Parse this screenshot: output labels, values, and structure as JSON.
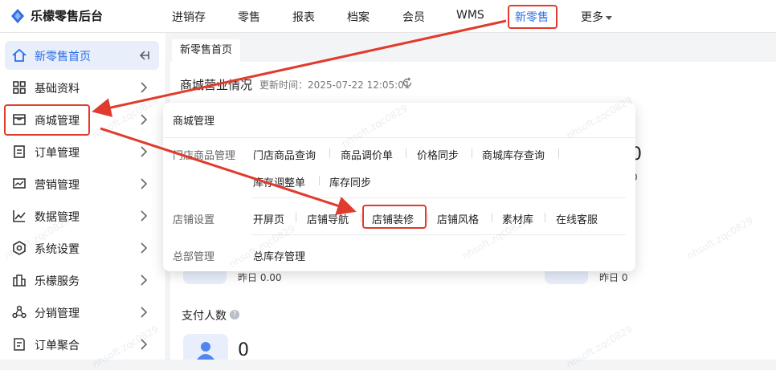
{
  "app": {
    "title": "乐檬零售后台"
  },
  "topnav": {
    "items": [
      "进销存",
      "零售",
      "报表",
      "档案",
      "会员",
      "WMS",
      "新零售",
      "更多"
    ],
    "active": "新零售"
  },
  "sidebar": {
    "items": [
      {
        "label": "新零售首页",
        "icon": "home-icon"
      },
      {
        "label": "基础资料",
        "icon": "grid-icon"
      },
      {
        "label": "商城管理",
        "icon": "store-icon"
      },
      {
        "label": "订单管理",
        "icon": "order-icon"
      },
      {
        "label": "营销管理",
        "icon": "marketing-icon"
      },
      {
        "label": "数据管理",
        "icon": "chart-line-icon"
      },
      {
        "label": "系统设置",
        "icon": "settings-icon"
      },
      {
        "label": "乐檬服务",
        "icon": "service-icon"
      },
      {
        "label": "分销管理",
        "icon": "distribution-icon"
      },
      {
        "label": "订单聚合",
        "icon": "aggregate-icon"
      }
    ]
  },
  "tabs": [
    {
      "label": "新零售首页"
    }
  ],
  "main": {
    "title": "商城营业情况",
    "updated_label": "更新时间：",
    "updated_time": "2025-07-22 12:05:01",
    "stat_zero": "0",
    "yesterday": "昨日 0.00",
    "yesterday_count": "昨日 0",
    "pay_count_label": "支付人数",
    "pay_count_value": "0",
    "help": "?"
  },
  "dropdown": {
    "title": "商城管理",
    "sections": [
      {
        "category": "门店商品管理",
        "links": [
          "门店商品查询",
          "商品调价单",
          "价格同步",
          "商城库存查询",
          "库存调整单",
          "库存同步"
        ]
      },
      {
        "category": "店铺设置",
        "links": [
          "开屏页",
          "店铺导航",
          "店铺装修",
          "店铺风格",
          "素材库",
          "在线客服"
        ]
      },
      {
        "category": "总部管理",
        "links": [
          "总库存管理"
        ]
      }
    ]
  },
  "watermark": "nhsoft.zqc0829",
  "colors": {
    "accent": "#2b6de5",
    "highlight": "#e03b2c"
  }
}
